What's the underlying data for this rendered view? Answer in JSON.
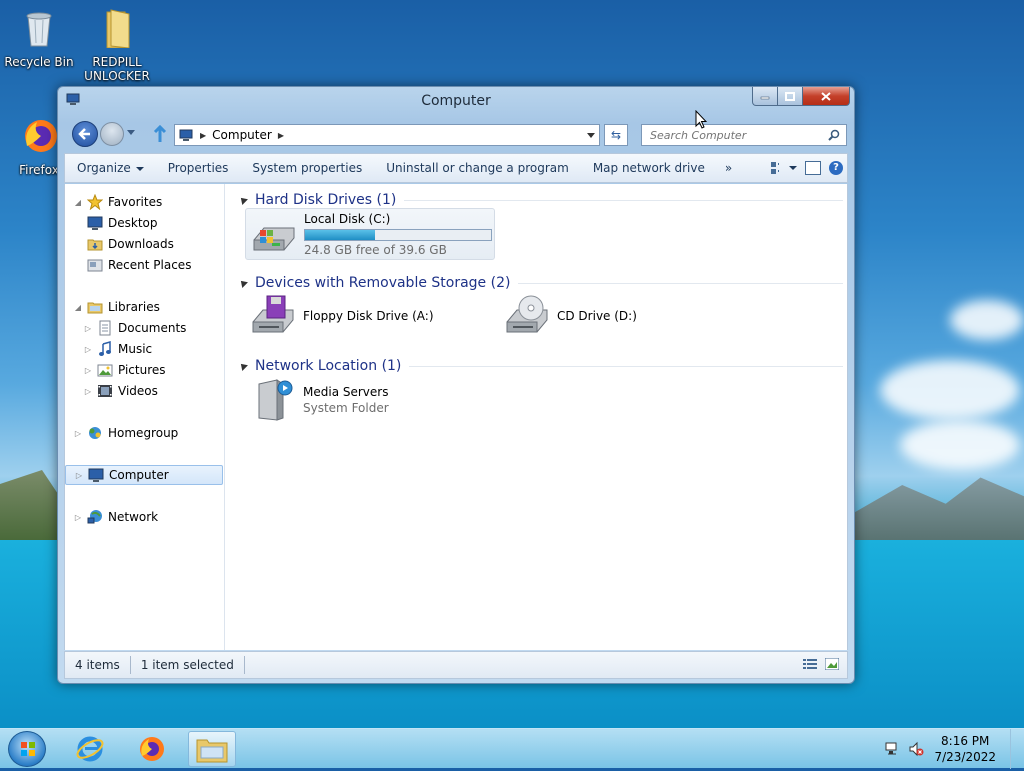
{
  "desktop": {
    "icons": [
      {
        "label": "Recycle Bin"
      },
      {
        "label": "REDPILL UNLOCKER"
      },
      {
        "label": "Firefox"
      }
    ]
  },
  "window": {
    "title": "Computer",
    "address": {
      "path": "Computer"
    },
    "search": {
      "placeholder": "Search Computer"
    },
    "toolbar": {
      "organize": "Organize",
      "properties": "Properties",
      "system_properties": "System properties",
      "uninstall": "Uninstall or change a program",
      "map_drive": "Map network drive",
      "more": "»"
    },
    "nav": {
      "favorites": "Favorites",
      "desktop": "Desktop",
      "downloads": "Downloads",
      "recent_places": "Recent Places",
      "libraries": "Libraries",
      "documents": "Documents",
      "music": "Music",
      "pictures": "Pictures",
      "videos": "Videos",
      "homegroup": "Homegroup",
      "computer": "Computer",
      "network": "Network"
    },
    "groups": {
      "hdd": "Hard Disk Drives (1)",
      "removable": "Devices with Removable Storage (2)",
      "network": "Network Location (1)"
    },
    "drives": {
      "local": {
        "name": "Local Disk (C:)",
        "free": "24.8 GB free of 39.6 GB",
        "used_fraction": 0.374
      },
      "floppy": {
        "name": "Floppy Disk Drive (A:)"
      },
      "cd": {
        "name": "CD Drive (D:)"
      },
      "media": {
        "name": "Media Servers",
        "sub": "System Folder"
      }
    },
    "status": {
      "items": "4 items",
      "selected": "1 item selected"
    }
  },
  "taskbar": {
    "time": "8:16 PM",
    "date": "7/23/2022"
  },
  "colors": {
    "group_heading": "#1e3287",
    "bar_fill": "#1f8ec4"
  }
}
